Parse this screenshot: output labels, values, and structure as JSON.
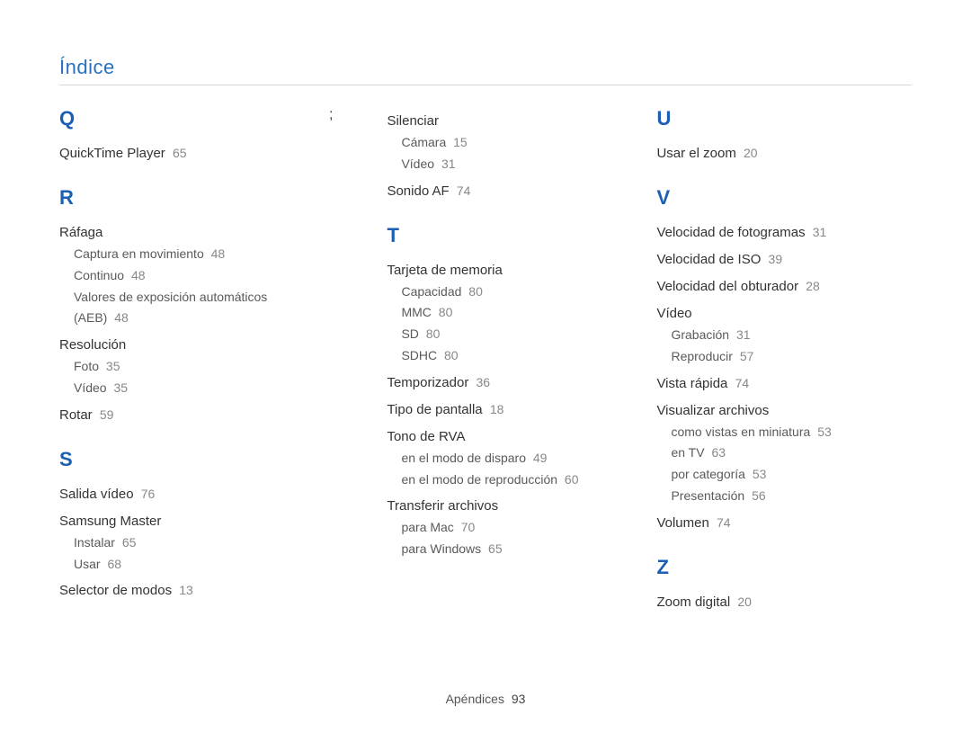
{
  "header": "Índice",
  "footer": {
    "label": "Apéndices",
    "page": "93"
  },
  "letters": {
    "Q": "Q",
    "R": "R",
    "S": "S",
    "T": "T",
    "U": "U",
    "V": "V",
    "Z": "Z"
  },
  "q": {
    "quicktime": {
      "label": "QuickTime Player",
      "page": "65"
    }
  },
  "r": {
    "rafaga": {
      "label": "Ráfaga"
    },
    "rafaga_captura": {
      "label": "Captura en movimiento",
      "page": "48"
    },
    "rafaga_continuo": {
      "label": "Continuo",
      "page": "48"
    },
    "rafaga_aeb": {
      "label": "Valores de exposición automáticos (AEB)",
      "page": "48"
    },
    "resolucion": {
      "label": "Resolución"
    },
    "resolucion_foto": {
      "label": "Foto",
      "page": "35"
    },
    "resolucion_video": {
      "label": "Vídeo",
      "page": "35"
    },
    "rotar": {
      "label": "Rotar",
      "page": "59"
    }
  },
  "s": {
    "salida_video": {
      "label": "Salida vídeo",
      "page": "76"
    },
    "samsung_master": {
      "label": "Samsung Master"
    },
    "samsung_instalar": {
      "label": "Instalar",
      "page": "65"
    },
    "samsung_usar": {
      "label": "Usar",
      "page": "68"
    },
    "selector_modos": {
      "label": "Selector de modos",
      "page": "13"
    },
    "silenciar": {
      "label": "Silenciar"
    },
    "silenciar_camara": {
      "label": "Cámara",
      "page": "15"
    },
    "silenciar_video": {
      "label": "Vídeo",
      "page": "31"
    },
    "sonido_af": {
      "label": "Sonido AF",
      "page": "74"
    }
  },
  "t": {
    "tarjeta": {
      "label": "Tarjeta de memoria"
    },
    "tarjeta_capacidad": {
      "label": "Capacidad",
      "page": "80"
    },
    "tarjeta_mmc": {
      "label": "MMC",
      "page": "80"
    },
    "tarjeta_sd": {
      "label": "SD",
      "page": "80"
    },
    "tarjeta_sdhc": {
      "label": "SDHC",
      "page": "80"
    },
    "temporizador": {
      "label": "Temporizador",
      "page": "36"
    },
    "tipo_pantalla": {
      "label": "Tipo de pantalla",
      "page": "18"
    },
    "tono_rva": {
      "label": "Tono de RVA"
    },
    "tono_disparo": {
      "label": "en el modo de disparo",
      "page": "49"
    },
    "tono_reproduccion": {
      "label": "en el modo de reproducción",
      "page": "60"
    },
    "transferir": {
      "label": "Transferir archivos"
    },
    "transferir_mac": {
      "label": "para Mac",
      "page": "70"
    },
    "transferir_windows": {
      "label": "para Windows",
      "page": "65"
    }
  },
  "u": {
    "usar_zoom": {
      "label": "Usar el zoom",
      "page": "20"
    }
  },
  "v": {
    "vel_fotogramas": {
      "label": "Velocidad de fotogramas",
      "page": "31"
    },
    "vel_iso": {
      "label": "Velocidad de ISO",
      "page": "39"
    },
    "vel_obturador": {
      "label": "Velocidad del obturador",
      "page": "28"
    },
    "video": {
      "label": "Vídeo"
    },
    "video_grabacion": {
      "label": "Grabación",
      "page": "31"
    },
    "video_reproducir": {
      "label": "Reproducir",
      "page": "57"
    },
    "vista_rapida": {
      "label": "Vista rápida",
      "page": "74"
    },
    "visualizar": {
      "label": "Visualizar archivos"
    },
    "visualizar_miniatura": {
      "label": "como vistas en miniatura",
      "page": "53"
    },
    "visualizar_tv": {
      "label": "en TV",
      "page": "63"
    },
    "visualizar_categoria": {
      "label": "por categoría",
      "page": "53"
    },
    "visualizar_presentacion": {
      "label": "Presentación",
      "page": "56"
    },
    "volumen": {
      "label": "Volumen",
      "page": "74"
    }
  },
  "z": {
    "zoom_digital": {
      "label": "Zoom digital",
      "page": "20"
    }
  }
}
